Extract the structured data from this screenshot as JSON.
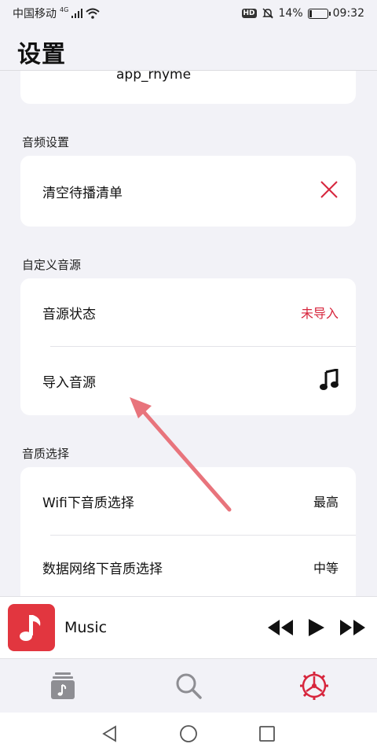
{
  "status_bar": {
    "carrier": "中国移动",
    "network": "4G",
    "battery": "14%",
    "time": "09:32",
    "battery_level": 0.14
  },
  "header": {
    "title": "设置"
  },
  "partial_row": {
    "value": "app_rhyme"
  },
  "sections": {
    "audio": {
      "title": "音频设置",
      "clear_queue_label": "清空待播清单"
    },
    "custom_source": {
      "title": "自定义音源",
      "status_label": "音源状态",
      "status_value": "未导入",
      "import_label": "导入音源"
    },
    "quality": {
      "title": "音质选择",
      "wifi_label": "Wifi下音质选择",
      "wifi_value": "最高",
      "mobile_label": "数据网络下音质选择",
      "mobile_value": "中等"
    }
  },
  "player": {
    "title": "Music"
  },
  "colors": {
    "accent": "#d7263d",
    "album": "#e2363f",
    "arrow": "#e8747c"
  }
}
